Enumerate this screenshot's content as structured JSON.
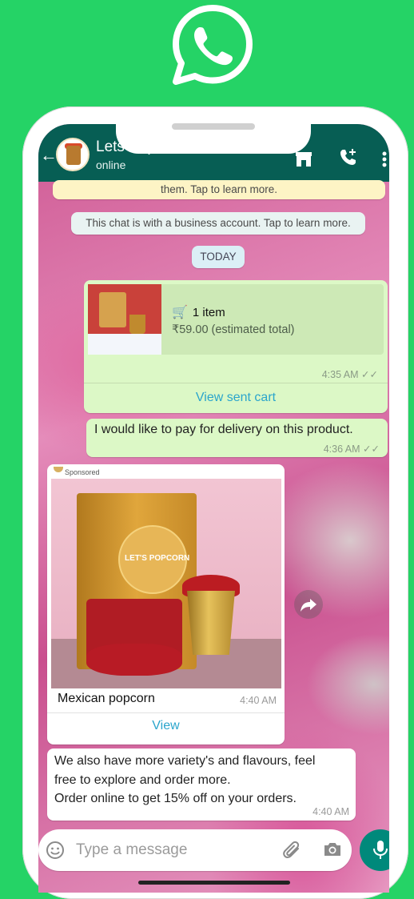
{
  "header": {
    "contact_name": "Lets Popcorn UAE",
    "status": "online",
    "back_icon": "back-arrow-icon",
    "store_icon": "store-icon",
    "call_icon": "add-call-icon",
    "more_icon": "more-vertical-icon"
  },
  "notices": {
    "encryption": "them. Tap to learn more.",
    "business": "This chat is with a business account. Tap to learn more.",
    "date": "TODAY"
  },
  "cart_message": {
    "items": "1 item",
    "total": "₹59.00 (estimated total)",
    "time": "4:35 AM",
    "link": "View sent cart"
  },
  "outgoing_message": {
    "text": "I would like to pay for delivery on this product.",
    "time": "4:36 AM"
  },
  "ad_message": {
    "sponsored": "Sponsored",
    "product_name": "Mexican popcorn",
    "time": "4:40 AM",
    "link": "View",
    "brand_on_bag": "LET'S POPCORN"
  },
  "incoming_message": {
    "line1": "We also have more variety's and flavours, feel",
    "line2": "free to explore and order more.",
    "line3": "Order online to get 15% off on your orders.",
    "time": "4:40 AM"
  },
  "composer": {
    "placeholder": "Type a message",
    "emoji_icon": "emoji-icon",
    "attach_icon": "attach-icon",
    "camera_icon": "camera-icon",
    "mic_icon": "mic-icon"
  },
  "colors": {
    "background": "#25d366",
    "header": "#075e54",
    "outgoing_bubble": "#dcf8c6",
    "link": "#2aa5cc"
  }
}
